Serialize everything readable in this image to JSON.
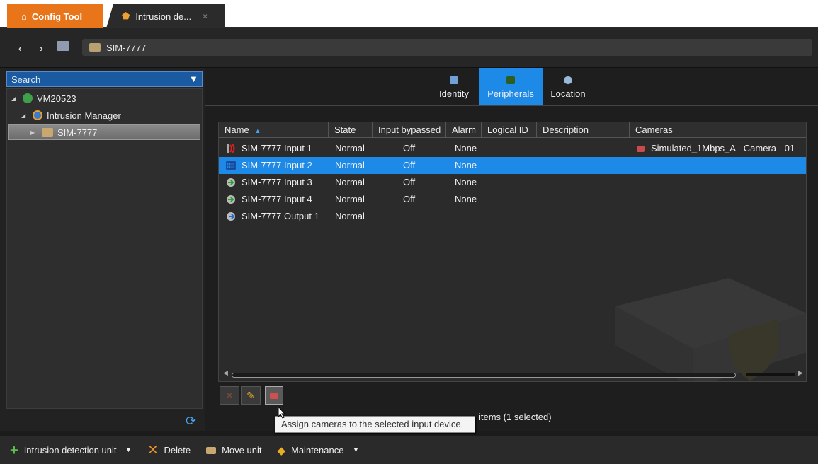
{
  "tabs": {
    "home_label": "Config Tool",
    "active_label": "Intrusion de...",
    "close_glyph": "×"
  },
  "nav": {
    "back_glyph": "‹",
    "forward_glyph": "›",
    "address": "SIM-7777"
  },
  "left": {
    "search_label": "Search",
    "tree": [
      {
        "label": "VM20523",
        "icon": "server-icon"
      },
      {
        "label": "Intrusion Manager",
        "icon": "intrusion-manager-icon"
      },
      {
        "label": "SIM-7777",
        "icon": "intrusion-unit-icon",
        "selected": true
      }
    ]
  },
  "main": {
    "prop_tabs": [
      {
        "label": "Identity",
        "icon": "identity-icon"
      },
      {
        "label": "Peripherals",
        "icon": "peripherals-icon",
        "active": true
      },
      {
        "label": "Location",
        "icon": "location-icon"
      }
    ],
    "columns": [
      "Name",
      "State",
      "Input bypassed",
      "Alarm",
      "Logical ID",
      "Description",
      "Cameras"
    ],
    "sort_glyph": "▲",
    "rows": [
      {
        "name": "SIM-7777 Input 1",
        "state": "Normal",
        "bypassed": "Off",
        "alarm": "None",
        "logical_id": "",
        "description": "",
        "cameras": "Simulated_1Mbps_A - Camera - 01",
        "icon": "input-alarm-icon"
      },
      {
        "name": "SIM-7777 Input 2",
        "state": "Normal",
        "bypassed": "Off",
        "alarm": "None",
        "logical_id": "",
        "description": "",
        "cameras": "",
        "icon": "input-grid-icon",
        "selected": true
      },
      {
        "name": "SIM-7777 Input 3",
        "state": "Normal",
        "bypassed": "Off",
        "alarm": "None",
        "logical_id": "",
        "description": "",
        "cameras": "",
        "icon": "input-icon"
      },
      {
        "name": "SIM-7777 Input 4",
        "state": "Normal",
        "bypassed": "Off",
        "alarm": "None",
        "logical_id": "",
        "description": "",
        "cameras": "",
        "icon": "input-icon"
      },
      {
        "name": "SIM-7777 Output 1",
        "state": "Normal",
        "bypassed": "",
        "alarm": "",
        "logical_id": "",
        "description": "",
        "cameras": "",
        "icon": "output-icon"
      }
    ],
    "items_count": "items (1 selected)",
    "tooltip": "Assign cameras to the selected input device."
  },
  "bottom": {
    "add_unit": "Intrusion detection unit",
    "delete": "Delete",
    "move_unit": "Move unit",
    "maintenance": "Maintenance"
  },
  "colors": {
    "accent": "#1e8ae8",
    "home_tab": "#e8751a"
  }
}
